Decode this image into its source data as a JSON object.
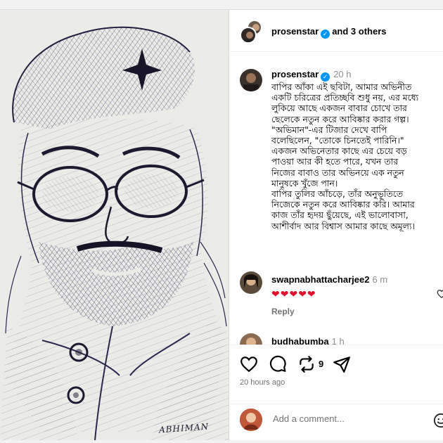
{
  "post": {
    "header": {
      "username": "prosenstar",
      "verified_mark": "✓",
      "and_others": "and 3 others"
    },
    "caption": {
      "username": "prosenstar",
      "time": "20 h",
      "text": "বাপির আঁকা এই ছবিটা, আমার অভিনীত\nএকটি চরিত্রের প্রতিচ্ছবি শুধু নয়, এর মধ্যে\nলুকিয়ে আছে একজন বাবার চোখে তার\nছেলেকে নতুন করে আবিষ্কার করার গল্প।\n\"অভিমান\"-এর টিজার দেখে বাপি\nবলেছিলেন, \"তোকে চিনতেই পারিনি।\"\nএকজন অভিনেতার কাছে এর চেয়ে বড়\nপাওয়া আর কী হতে পারে, যখন তার\nনিজের বাবাও তার অভিনয়ে এক নতুন\nমানুষকে খুঁজে পান।\nবাপির তুলির আঁচড়ে, তাঁর অনুভূতিতে\nনিজেকে নতুন করে আবিষ্কার করি। আমার\nকাজ তাঁর হৃদয় ছুঁয়েছে, এই ভালোবাসা,\nআশীর্বাদ আর বিশ্বাস আমার কাছে অমূল্য।"
    },
    "comments": [
      {
        "username": "swapnabhattacharjee2",
        "time": "6 m",
        "text": "❤❤❤❤❤",
        "reply_label": "Reply"
      },
      {
        "username": "budhabumba",
        "time": "1 h"
      }
    ],
    "actions": {
      "repost_count": "9",
      "timestamp": "20 hours ago"
    },
    "add_comment": {
      "placeholder": "Add a comment..."
    },
    "image_signature": "ABHIMAN"
  },
  "icons": [
    "heart-icon",
    "comment-icon",
    "repost-icon",
    "share-icon",
    "emoji-icon",
    "verified-icon"
  ],
  "colors": {
    "verified": "#0095f6",
    "hearts": "#e0102a",
    "secondary_text": "#737373"
  }
}
